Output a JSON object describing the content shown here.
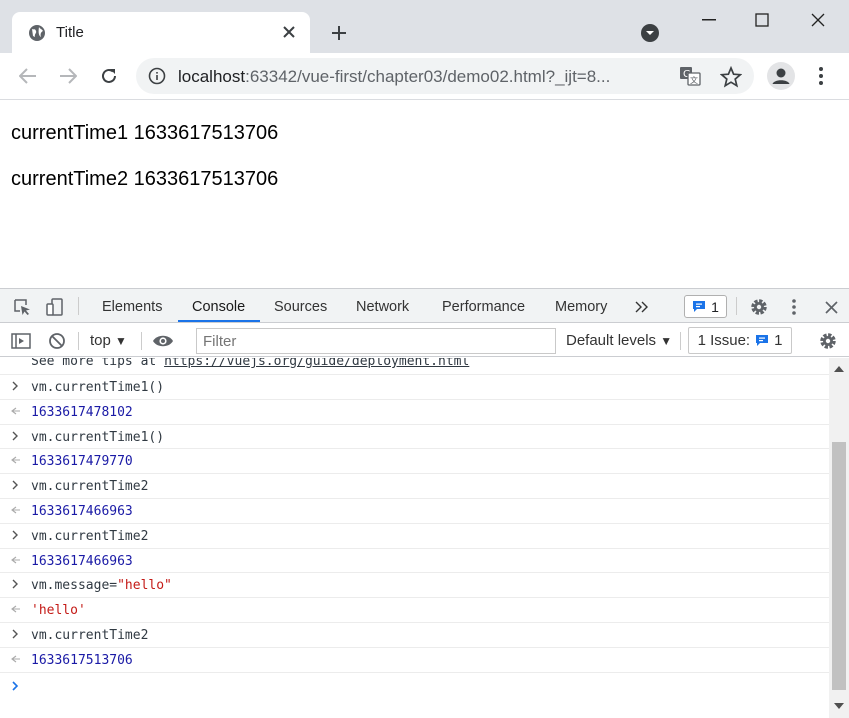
{
  "browser": {
    "tab_title": "Title",
    "url_host": "localhost",
    "url_rest": ":63342/vue-first/chapter03/demo02.html?_ijt=8..."
  },
  "page": {
    "line1": "currentTime1 1633617513706",
    "line2": "currentTime2 1633617513706"
  },
  "devtools": {
    "tabs": [
      "Elements",
      "Console",
      "Sources",
      "Network",
      "Performance",
      "Memory"
    ],
    "active_tab": "Console",
    "message_count": "1",
    "context": "top",
    "filter_placeholder": "Filter",
    "levels": "Default levels",
    "issues_label": "1 Issue:",
    "issues_count": "1"
  },
  "console": {
    "tip_prefix": "See more tips at ",
    "tip_link": "https://vuejs.org/guide/deployment.html",
    "entries": [
      {
        "kind": "input",
        "text": "vm.currentTime1()"
      },
      {
        "kind": "output",
        "text": "1633617478102"
      },
      {
        "kind": "input",
        "text": "vm.currentTime1()"
      },
      {
        "kind": "output",
        "text": "1633617479770"
      },
      {
        "kind": "input",
        "text": "vm.currentTime2"
      },
      {
        "kind": "output",
        "text": "1633617466963"
      },
      {
        "kind": "input",
        "text": "vm.currentTime2"
      },
      {
        "kind": "output",
        "text": "1633617466963"
      },
      {
        "kind": "input",
        "text": "vm.message=",
        "string_part": "\"hello\""
      },
      {
        "kind": "output-string",
        "text": "'hello'"
      },
      {
        "kind": "input",
        "text": "vm.currentTime2"
      },
      {
        "kind": "output",
        "text": "1633617513706"
      }
    ]
  },
  "colors": {
    "accent": "#1a73e8",
    "number": "#1a1aa6",
    "string": "#c41a16"
  }
}
